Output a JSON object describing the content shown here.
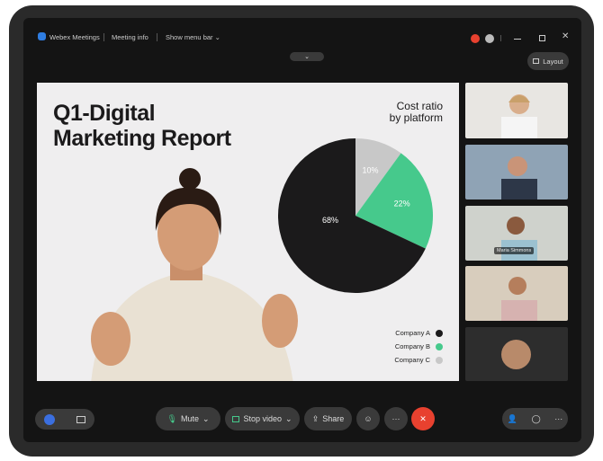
{
  "titlebar": {
    "app_name": "Webex Meetings",
    "meeting_info": "Meeting info",
    "show_menu_bar": "Show menu bar"
  },
  "layout_label": "Layout",
  "slide": {
    "title_line1": "Q1-Digital",
    "title_line2": "Marketing Report",
    "chart_title_line1": "Cost ratio",
    "chart_title_line2": "by platform"
  },
  "chart_data": {
    "type": "pie",
    "title": "Cost ratio by platform",
    "categories": [
      "Company A",
      "Company B",
      "Company C"
    ],
    "values": [
      68,
      22,
      10
    ],
    "labels": [
      "68%",
      "22%",
      "10%"
    ],
    "colors": [
      "#1b1a1b",
      "#46c98c",
      "#c8c8c8"
    ]
  },
  "participants": [
    {
      "name": ""
    },
    {
      "name": ""
    },
    {
      "name": "Maria Simmons"
    },
    {
      "name": ""
    },
    {
      "name": ""
    }
  ],
  "controls": {
    "mute": "Mute",
    "stop_video": "Stop video",
    "share": "Share",
    "more": "···"
  },
  "colors": {
    "end_call": "#e8412f",
    "accent_green": "#46c98c"
  }
}
